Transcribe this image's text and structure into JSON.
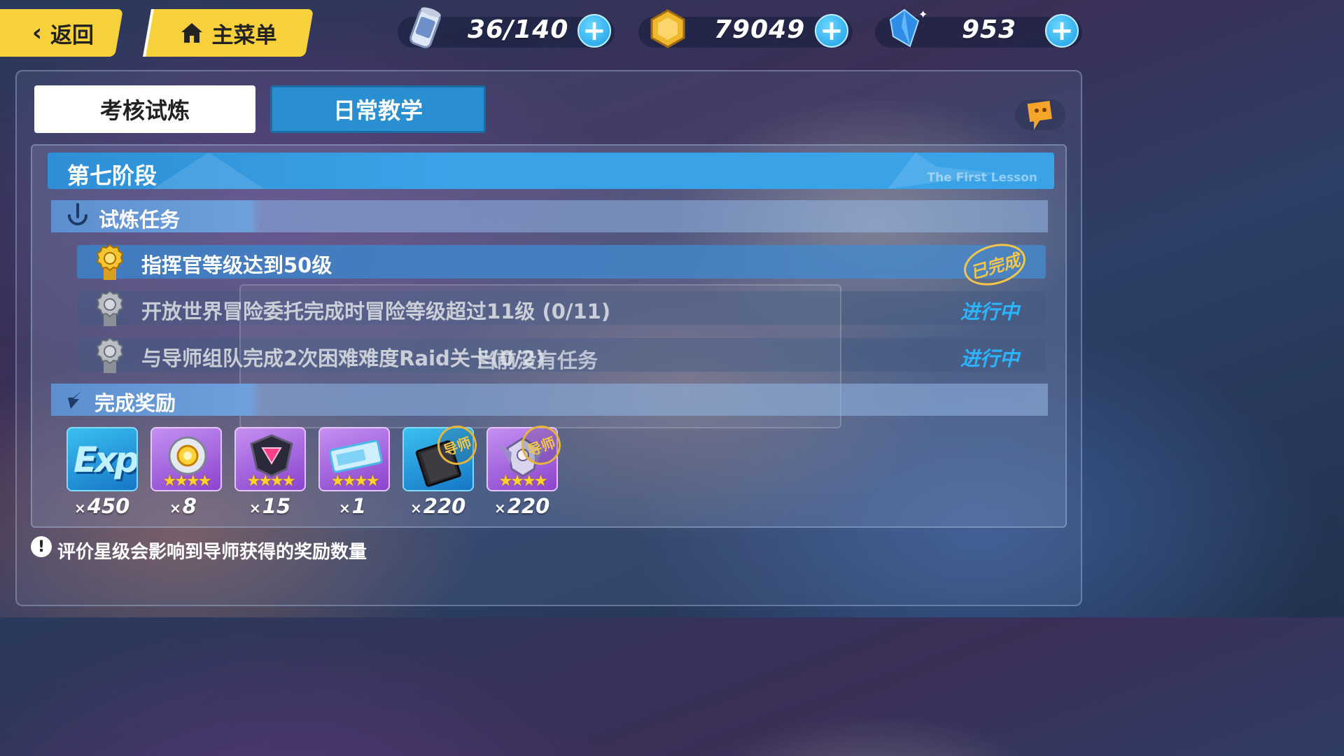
{
  "nav": {
    "back_label": "返回",
    "home_label": "主菜单"
  },
  "resources": [
    {
      "name": "stamina",
      "icon": "stamina-can-icon",
      "value": "36/140"
    },
    {
      "name": "coins",
      "icon": "coin-icon",
      "value": "79049"
    },
    {
      "name": "crystals",
      "icon": "crystal-icon",
      "value": "953"
    }
  ],
  "tabs": [
    {
      "label": "考核试炼",
      "active": true
    },
    {
      "label": "日常教学",
      "active": false
    }
  ],
  "stage": {
    "title": "第七阶段",
    "subtitle": "The First Lesson"
  },
  "task_section": {
    "title": "试炼任务"
  },
  "tasks": [
    {
      "text": "指挥官等级达到50级",
      "status": "已完成",
      "done": true
    },
    {
      "text": "开放世界冒险委托完成时冒险等级超过11级 (0/11)",
      "status": "进行中",
      "done": false
    },
    {
      "text": "与导师组队完成2次困难难度Raid关卡(0/2)",
      "status": "进行中",
      "done": false
    }
  ],
  "overlay_text": "当前没有任务",
  "reward_section": {
    "title": "完成奖励"
  },
  "rewards": [
    {
      "icon": "exp-icon",
      "label": "Exp",
      "qty": "450",
      "stars": 0,
      "mentor": false
    },
    {
      "icon": "gear-core-icon",
      "qty": "8",
      "stars": 4,
      "mentor": false
    },
    {
      "icon": "crystal-chip-icon",
      "qty": "15",
      "stars": 4,
      "mentor": false
    },
    {
      "icon": "ticket-icon",
      "qty": "1",
      "stars": 4,
      "mentor": false
    },
    {
      "icon": "book-icon",
      "qty": "220",
      "stars": 0,
      "mentor": true
    },
    {
      "icon": "emblem-icon",
      "qty": "220",
      "stars": 4,
      "mentor": true
    }
  ],
  "mentor_tag": "导师",
  "footer_note": "评价星级会影响到导师获得的奖励数量",
  "colors": {
    "accent_yellow": "#f7d13c",
    "accent_blue": "#2bb4ff",
    "stage_blue": "#3aa3e8"
  }
}
